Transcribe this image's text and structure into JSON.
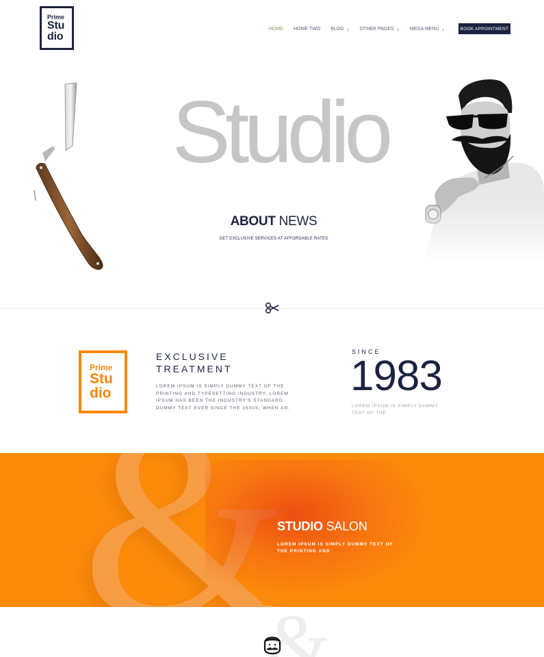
{
  "header": {
    "logo": {
      "line1": "Prime",
      "line2": "Stu",
      "line3": "dio"
    },
    "nav": [
      {
        "label": "HOME",
        "has_dropdown": false,
        "active": true
      },
      {
        "label": "HOME TWO",
        "has_dropdown": false,
        "active": false
      },
      {
        "label": "BLOG",
        "has_dropdown": true,
        "active": false
      },
      {
        "label": "OTHER PAGES",
        "has_dropdown": true,
        "active": false
      },
      {
        "label": "MEGA MENU",
        "has_dropdown": true,
        "active": false
      }
    ],
    "book_button": "BOOK APPOINTMENT"
  },
  "hero": {
    "big_word": "Studio",
    "heading_bold": "ABOUT",
    "heading_light": " NEWS",
    "tagline": "GET EXCLUSIVE SERVICES AT AFFORDABLE RATES"
  },
  "info": {
    "logo": {
      "line1": "Prime",
      "line2": "Stu",
      "line3": "dio"
    },
    "title_line1": "EXCLUSIVE",
    "title_line2": "TREATMENT",
    "description": "LOREM IPSUM IS SIMPLY DUMMY TEXT OF THE PRINTING AND TYPESETTING INDUSTRY. LOREM IPSUM HAS BEEN THE INDUSTRY'S STANDARD DUMMY TEXT EVER SINCE THE 1500S, WHEN AN.",
    "since_label": "SINCE",
    "year": "1983",
    "year_description": "LOREM IPSUM IS SIMPLY DUMMY TEXT OF THE"
  },
  "salon": {
    "title_bold": "STUDIO",
    "title_light": " SALON",
    "description": "LOREM IPSUM IS SIMPLY DUMMY TEXT OF THE PRINTING AND"
  },
  "colors": {
    "navy": "#1c2340",
    "orange": "#fd8b0b",
    "logo_orange": "#f7860a",
    "hero_word_gray": "#c6c6c6"
  },
  "icons": [
    "straight-razor-icon",
    "scissors-icon",
    "bearded-man-photo",
    "mustache-face-icon",
    "dropdown-arrow-icon"
  ]
}
